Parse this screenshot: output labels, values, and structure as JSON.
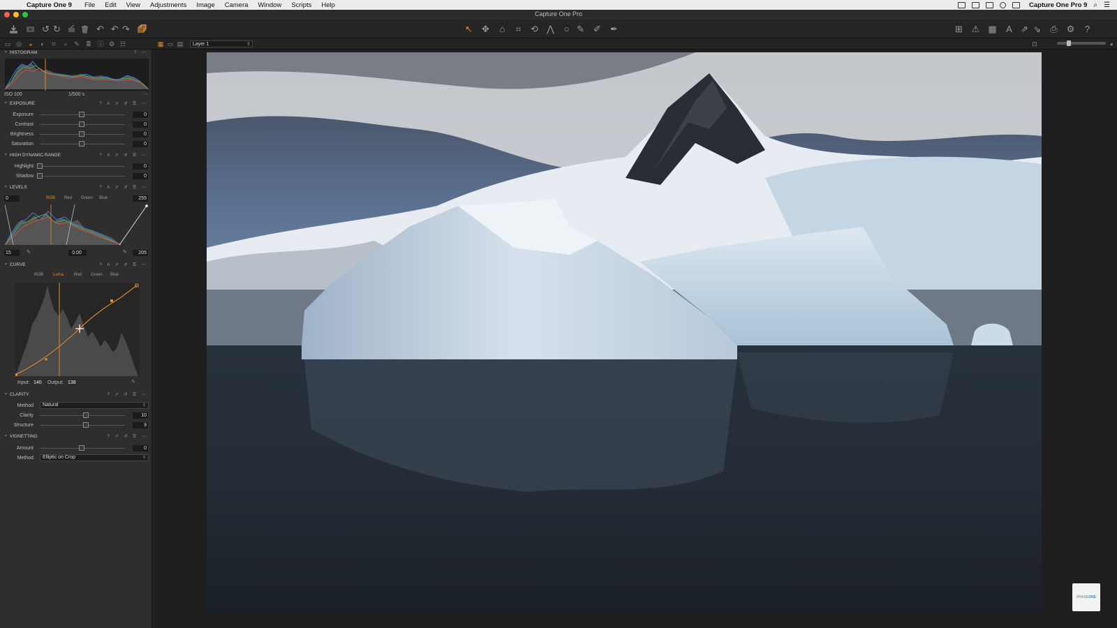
{
  "menubar": {
    "app_name": "Capture One 9",
    "menus": [
      "File",
      "Edit",
      "View",
      "Adjustments",
      "Image",
      "Camera",
      "Window",
      "Scripts",
      "Help"
    ],
    "right_title": "Capture One Pro 9"
  },
  "window": {
    "title": "Capture One Pro"
  },
  "toolbar": {
    "layer_select": "Layer 1",
    "cursor_tools": [
      "select-icon",
      "pan-icon",
      "loupe-icon",
      "crop-icon",
      "rotate-icon",
      "keystone-icon",
      "spot-removal-icon",
      "brush-icon",
      "eraser-icon",
      "gradient-icon"
    ]
  },
  "histogram": {
    "title": "Histogram",
    "iso": "ISO 100",
    "shutter": "1/500 s"
  },
  "exposure": {
    "title": "Exposure",
    "rows": [
      {
        "label": "Exposure",
        "value": "0",
        "level": 0.5
      },
      {
        "label": "Contrast",
        "value": "0",
        "level": 0.5
      },
      {
        "label": "Brightness",
        "value": "0",
        "level": 0.5
      },
      {
        "label": "Saturation",
        "value": "0",
        "level": 0.5
      }
    ]
  },
  "hdr": {
    "title": "High Dynamic Range",
    "rows": [
      {
        "label": "Highlight",
        "value": "0",
        "level": 0
      },
      {
        "label": "Shadow",
        "value": "0",
        "level": 0
      }
    ]
  },
  "levels": {
    "title": "Levels",
    "channels": [
      "RGB",
      "Red",
      "Green",
      "Blue"
    ],
    "active_channel": "RGB",
    "input_low": "0",
    "input_high": "255",
    "output_low": "15",
    "midpoint": "0.00",
    "output_high": "205"
  },
  "curve": {
    "title": "Curve",
    "channels": [
      "RGB",
      "Luma",
      "Red",
      "Green",
      "Blue"
    ],
    "active_channel": "Luma",
    "input_label": "Input:",
    "input_value": "140",
    "output_label": "Output:",
    "output_value": "138"
  },
  "clarity": {
    "title": "Clarity",
    "method_label": "Method",
    "method_value": "Natural",
    "rows": [
      {
        "label": "Clarity",
        "value": "10",
        "level": 0.55
      },
      {
        "label": "Structure",
        "value": "9",
        "level": 0.55
      }
    ]
  },
  "vignetting": {
    "title": "Vignetting",
    "amount_label": "Amount",
    "amount_value": "0",
    "amount_level": 0.5,
    "method_label": "Method",
    "method_value": "Elliptic on Crop"
  },
  "watermark": {
    "brand_a": "PHASE",
    "brand_b": "ONE"
  },
  "colors": {
    "accent": "#e08a2e",
    "panel": "#2e2e2f",
    "background": "#1f1f20"
  }
}
